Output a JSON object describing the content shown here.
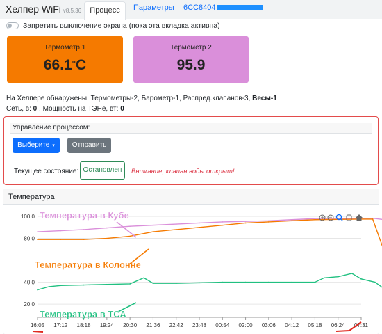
{
  "header": {
    "brand": "Хелпер WiFi",
    "version": "v8.5.36",
    "tabs": [
      {
        "label": "Процесс",
        "active": true
      },
      {
        "label": "Параметры",
        "active": false
      },
      {
        "label": "6CC8404",
        "active": false
      }
    ]
  },
  "screen_lock": {
    "label": "Запретить выключение экрана (пока эта вкладка активна)",
    "checked": false
  },
  "thermometers": [
    {
      "title": "Термометр 1",
      "value": "66.1",
      "unit": "C",
      "color": "#f57a00"
    },
    {
      "title": "Термометр 2",
      "value": "95.9",
      "unit": "",
      "color": "#da8fda"
    }
  ],
  "detected": {
    "prefix": "На Хелпере обнаружены: ",
    "items": "Термометры-2, Барометр-1, Распред.клапанов-3, ",
    "scale": "Весы-1"
  },
  "power": {
    "net_label": "Сеть, в: ",
    "net_value": "0",
    "sep": " , Мощность на ТЭНе, вт: ",
    "ten_value": "0"
  },
  "process": {
    "title": "Управление процессом:",
    "select_label": "Выберите",
    "send_label": "Отправить",
    "state_label": "Текущее состояние:",
    "state_value": "Остановлен",
    "warning": "Внимание, клапан воды открыт!"
  },
  "chart_card": {
    "title": "Температура",
    "toolbar_icons": [
      "zoom-in-icon",
      "zoom-out-icon",
      "magnifier-icon",
      "hand-icon",
      "home-icon"
    ]
  },
  "chart_data": {
    "type": "line",
    "title": "Температура",
    "x_ticks": [
      "16:05",
      "17:12",
      "18:18",
      "19:24",
      "20:30",
      "21:36",
      "22:42",
      "23:48",
      "00:54",
      "02:00",
      "03:06",
      "04:12",
      "05:18",
      "06:24",
      "07:31"
    ],
    "y_ticks": [
      "100.0",
      "80.0",
      "40.0",
      "20.0"
    ],
    "ylim": [
      8,
      107
    ],
    "series": [
      {
        "name": "Температура в Кубе",
        "color": "#da8fda",
        "x": [
          0,
          1,
          2,
          3,
          4,
          5,
          6,
          7,
          8,
          9,
          10,
          11,
          12,
          13,
          14,
          14.5,
          15
        ],
        "y": [
          86,
          87,
          88,
          89.5,
          91,
          92,
          93,
          94,
          95,
          95.5,
          96,
          97,
          98,
          98.2,
          98.3,
          98.3,
          97
        ]
      },
      {
        "name": "Температура в Колонне",
        "color": "#f57a00",
        "x": [
          0,
          1,
          2,
          3,
          4,
          5,
          6,
          7,
          8,
          9,
          10,
          11,
          12,
          13,
          14,
          14.5,
          15
        ],
        "y": [
          79,
          79,
          79,
          80,
          82,
          86,
          88,
          90,
          92,
          94,
          95,
          96,
          97,
          97.3,
          97.5,
          97.5,
          68
        ]
      },
      {
        "name": "Температура в ТСА",
        "color": "#20c080",
        "x": [
          0,
          0.5,
          1,
          2,
          3,
          4,
          4.6,
          5,
          6,
          7,
          8,
          9,
          10,
          11,
          12,
          12.4,
          13,
          13.6,
          14,
          14.6,
          15
        ],
        "y": [
          33,
          36,
          37,
          37.5,
          38,
          38.5,
          44,
          39,
          39,
          39.5,
          40,
          40,
          40,
          40,
          40,
          44,
          45,
          48,
          43,
          40,
          34
        ]
      }
    ],
    "legend": "inline"
  }
}
